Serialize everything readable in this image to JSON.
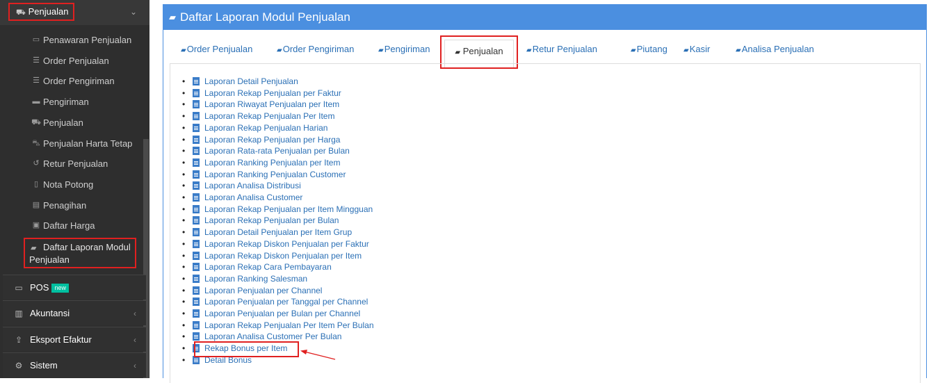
{
  "sidebar": {
    "header": {
      "label": "Penjualan",
      "icon": "cart-icon",
      "chevron": "⌄"
    },
    "sub_items": [
      {
        "label": "Penawaran Penjualan",
        "icon": "card-icon",
        "glyph": "▭"
      },
      {
        "label": "Order Penjualan",
        "icon": "list-icon",
        "glyph": "☰"
      },
      {
        "label": "Order Pengiriman",
        "icon": "ordered-list-icon",
        "glyph": "☰"
      },
      {
        "label": "Pengiriman",
        "icon": "truck-icon",
        "glyph": "▬"
      },
      {
        "label": "Penjualan",
        "icon": "cart-icon",
        "glyph": "⛟"
      },
      {
        "label": "Penjualan Harta Tetap",
        "icon": "car-icon",
        "glyph": "⛍"
      },
      {
        "label": "Retur Penjualan",
        "icon": "undo-icon",
        "glyph": "↺"
      },
      {
        "label": "Nota Potong",
        "icon": "file-icon",
        "glyph": "▯"
      },
      {
        "label": "Penagihan",
        "icon": "invoice-icon",
        "glyph": "▤"
      },
      {
        "label": "Daftar Harga",
        "icon": "money-icon",
        "glyph": "▣"
      }
    ],
    "active_item": {
      "label": "Daftar Laporan Modul Penjualan",
      "icon": "book-icon"
    },
    "main_items": [
      {
        "label": "POS",
        "icon": "monitor-icon",
        "glyph": "▭",
        "badge": "new",
        "chevron": ""
      },
      {
        "label": "Akuntansi",
        "icon": "bar-chart-icon",
        "glyph": "▥",
        "badge": "",
        "chevron": "‹"
      },
      {
        "label": "Eksport Efaktur",
        "icon": "export-icon",
        "glyph": "⇪",
        "badge": "",
        "chevron": "‹"
      },
      {
        "label": "Sistem",
        "icon": "cogs-icon",
        "glyph": "⚙",
        "badge": "",
        "chevron": "‹"
      }
    ]
  },
  "panel": {
    "title": "Daftar Laporan Modul Penjualan",
    "title_icon": "book-icon"
  },
  "tabs": [
    {
      "label": "Order Penjualan",
      "active": false
    },
    {
      "label": "Order Pengiriman",
      "active": false
    },
    {
      "label": "Pengiriman",
      "active": false
    },
    {
      "label": "Penjualan",
      "active": true
    },
    {
      "label": "Retur Penjualan",
      "active": false
    },
    {
      "label": "Piutang",
      "active": false
    },
    {
      "label": "Kasir",
      "active": false
    },
    {
      "label": "Analisa Penjualan",
      "active": false
    }
  ],
  "reports": [
    "Laporan Detail Penjualan",
    "Laporan Rekap Penjualan per Faktur",
    "Laporan Riwayat Penjualan per Item",
    "Laporan Rekap Penjualan Per Item",
    "Laporan Rekap Penjualan Harian",
    "Laporan Rekap Penjualan per Harga",
    "Laporan Rata-rata Penjualan per Bulan",
    "Laporan Ranking Penjualan per Item",
    "Laporan Ranking Penjualan Customer",
    "Laporan Analisa Distribusi",
    "Laporan Analisa Customer",
    "Laporan Rekap Penjualan per Item Mingguan",
    "Laporan Rekap Penjualan per Bulan",
    "Laporan Detail Penjualan per Item Grup",
    "Laporan Rekap Diskon Penjualan per Faktur",
    "Laporan Rekap Diskon Penjualan per Item",
    "Laporan Rekap Cara Pembayaran",
    "Laporan Ranking Salesman",
    "Laporan Penjualan per Channel",
    "Laporan Penjualan per Tanggal per Channel",
    "Laporan Penjualan per Bulan per Channel",
    "Laporan Rekap Penjualan Per Item Per Bulan",
    "Laporan Analisa Customer Per Bulan",
    "Rekap Bonus per Item",
    "Detail Bonus"
  ],
  "highlighted_report": "Rekap Bonus per Item",
  "colors": {
    "accent": "#4b8fe0",
    "link": "#2a6fb5",
    "highlight": "#e02020",
    "sidebar_bg": "#2e2e2e"
  }
}
